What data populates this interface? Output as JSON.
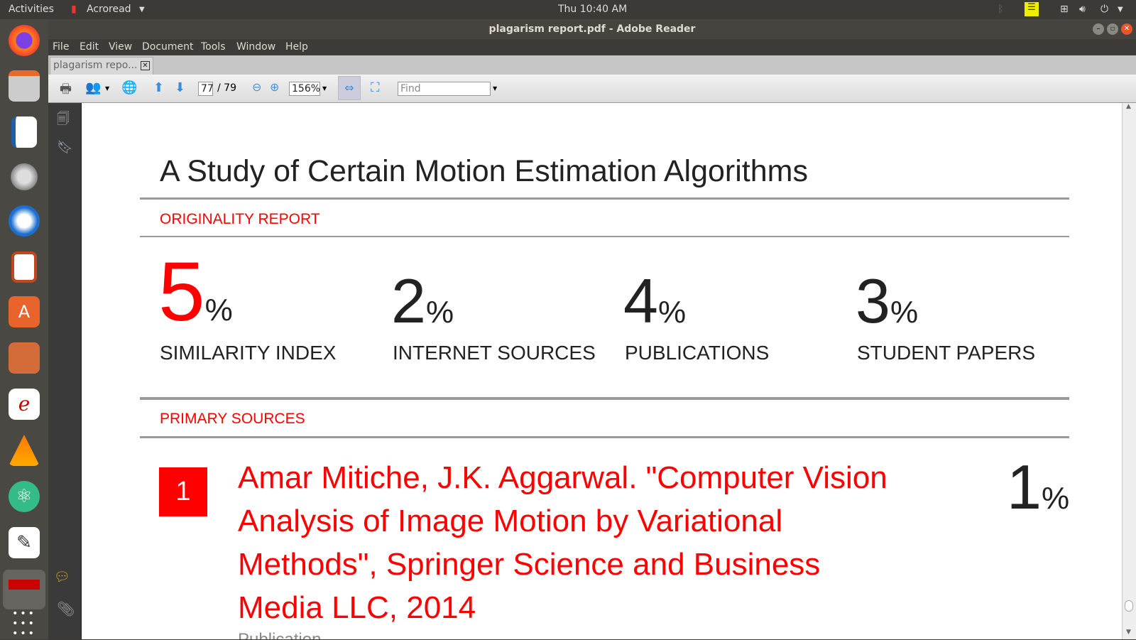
{
  "topbar": {
    "activities": "Activities",
    "app": "Acroread",
    "clock": "Thu 10:40 AM"
  },
  "window": {
    "title": "plagarism report.pdf - Adobe Reader"
  },
  "menu": [
    "File",
    "Edit",
    "View",
    "Document",
    "Tools",
    "Window",
    "Help"
  ],
  "tab": {
    "label": "plagarism repo..."
  },
  "toolbar": {
    "page_current": "77",
    "page_total": "/ 79",
    "zoom": "156%",
    "find_placeholder": "Find"
  },
  "document": {
    "title": "A Study of Certain Motion Estimation Algorithms",
    "originality_heading": "ORIGINALITY REPORT",
    "stats": [
      {
        "value": "5",
        "unit": "%",
        "label": "SIMILARITY INDEX"
      },
      {
        "value": "2",
        "unit": "%",
        "label": "INTERNET SOURCES"
      },
      {
        "value": "4",
        "unit": "%",
        "label": "PUBLICATIONS"
      },
      {
        "value": "3",
        "unit": "%",
        "label": "STUDENT PAPERS"
      }
    ],
    "primary_heading": "PRIMARY SOURCES",
    "sources": [
      {
        "rank": "1",
        "lines": [
          "Amar Mitiche, J.K. Aggarwal. \"Computer Vision",
          "Analysis of Image Motion by Variational",
          "Methods\", Springer Science and Business",
          "Media LLC, 2014"
        ],
        "type": "Publication",
        "percent": "1",
        "unit": "%"
      }
    ]
  },
  "colors": {
    "accent": "#ff0000"
  }
}
